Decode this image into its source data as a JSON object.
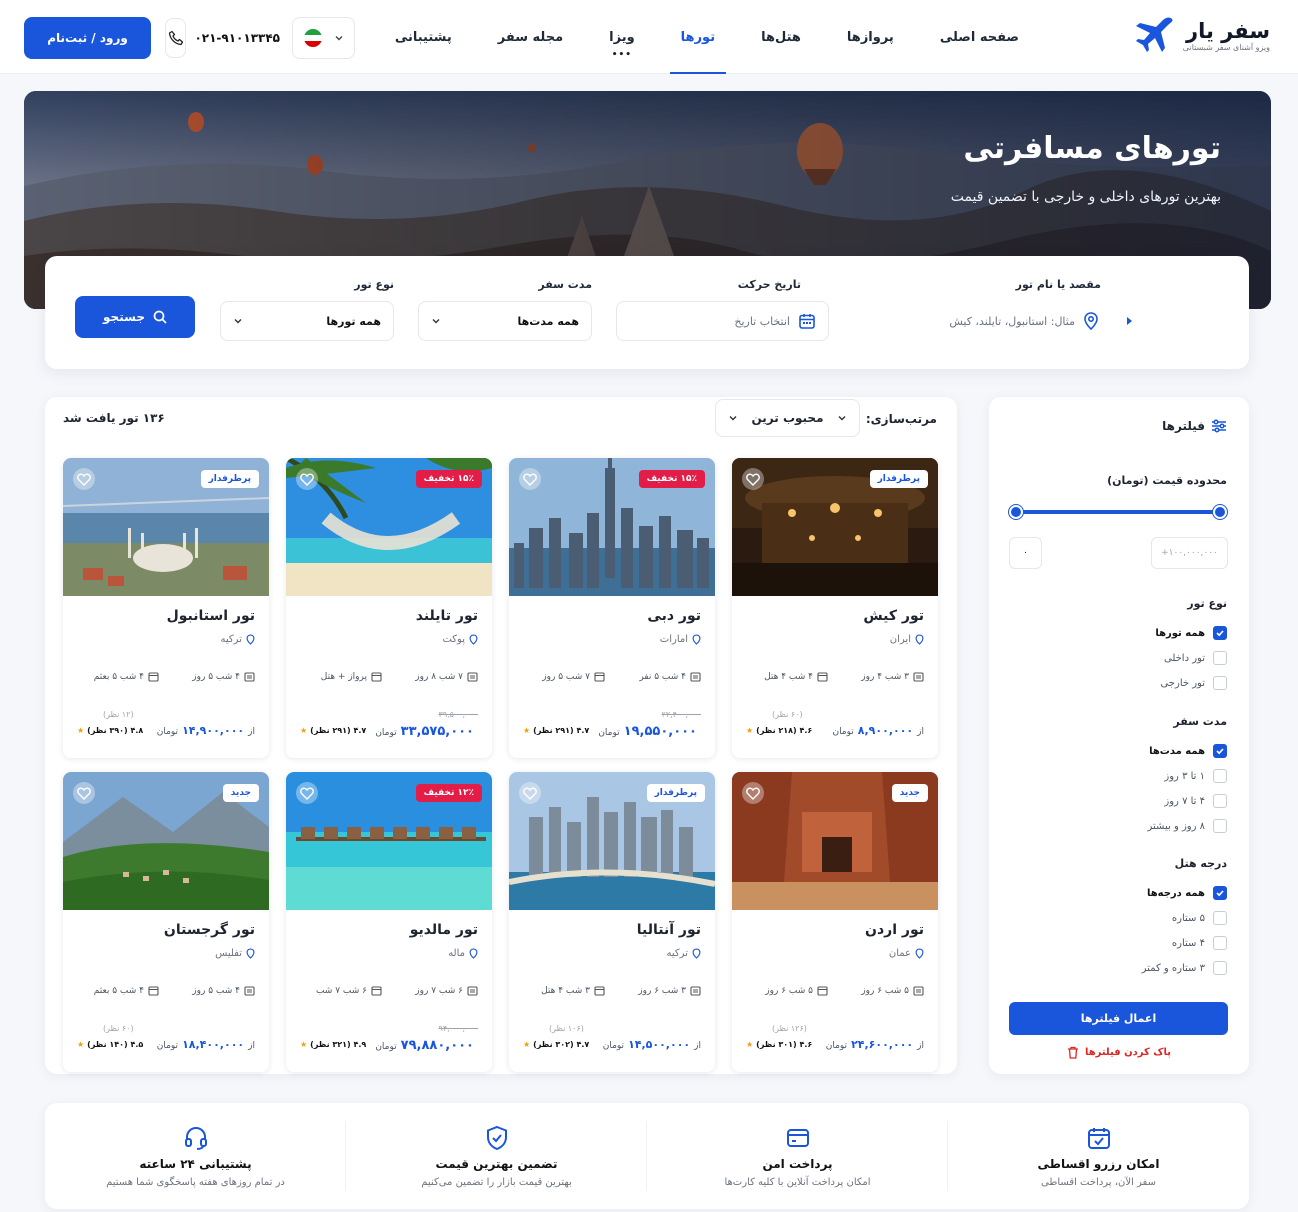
{
  "header": {
    "logo_title": "سفر یار",
    "logo_sub": "ویزو آشنای سفر شبستانی",
    "nav": [
      {
        "label": "صفحه اصلی",
        "active": false
      },
      {
        "label": "پروازها",
        "active": false
      },
      {
        "label": "هتل‌ها",
        "active": false
      },
      {
        "label": "تورها",
        "active": true
      },
      {
        "label": "ویزا",
        "active": false,
        "sub": "•••"
      },
      {
        "label": "مجله سفر",
        "active": false
      },
      {
        "label": "پشتیبانی",
        "active": false
      }
    ],
    "phone": "۰۲۱-۹۱۰۱۳۳۴۵",
    "login_label": "ورود / ثبت‌نام"
  },
  "hero": {
    "title": "تورهای مسافرتی",
    "subtitle": "بهترین تورهای داخلی و خارجی با تضمین قیمت"
  },
  "search": {
    "destination_label": "مقصد یا نام تور",
    "destination_placeholder": "مثال: استانبول، تایلند، کیش",
    "date_label": "تاریخ حرکت",
    "date_placeholder": "انتخاب تاریخ",
    "duration_label": "مدت سفر",
    "duration_value": "همه مدت‌ها",
    "type_label": "نوع تور",
    "type_value": "همه تورها",
    "search_label": "جستجو"
  },
  "results": {
    "sort_label": "مرتب‌سازی:",
    "sort_value": "محبوب ترین",
    "count_text": "۱۳۶ تور یافت شد"
  },
  "filters": {
    "title": "فیلترها",
    "price_title": "محدوده قیمت (تومان)",
    "price_min": "۰",
    "price_max": "۱۰۰,۰۰۰,۰۰۰+",
    "type_title": "نوع تور",
    "type_options": [
      {
        "label": "همه تورها",
        "checked": true
      },
      {
        "label": "تور داخلی",
        "checked": false
      },
      {
        "label": "تور خارجی",
        "checked": false
      }
    ],
    "duration_title": "مدت سفر",
    "duration_options": [
      {
        "label": "همه مدت‌ها",
        "checked": true
      },
      {
        "label": "۱ تا ۳ روز",
        "checked": false
      },
      {
        "label": "۴ تا ۷ روز",
        "checked": false
      },
      {
        "label": "۸ روز و بیشتر",
        "checked": false
      }
    ],
    "hotel_title": "درجه هتل",
    "hotel_options": [
      {
        "label": "همه درجه‌ها",
        "checked": true
      },
      {
        "label": "۵ ستاره",
        "checked": false
      },
      {
        "label": "۴ ستاره",
        "checked": false
      },
      {
        "label": "۳ ستاره و کمتر",
        "checked": false
      }
    ],
    "apply_label": "اعمال فیلترها",
    "clear_label": "پاک کردن فیلترها"
  },
  "tours": [
    {
      "title": "تور کیش",
      "location": "ایران",
      "badge": "پرطرفدار",
      "badge_style": "white",
      "feat1": "۳ شب ۴ روز",
      "feat2": "۴ شب ۴ هتل",
      "old_price": "",
      "reviews": "(۶۰ نظر)",
      "price_prefix": "از",
      "price": "۸,۹۰۰,۰۰۰",
      "currency": "تومان",
      "rating": "۴.۶ (۲۱۸ نظر)",
      "big": false,
      "img": "kish"
    },
    {
      "title": "تور دبی",
      "location": "امارات",
      "badge": "۱۵٪ تخفیف",
      "badge_style": "red",
      "feat1": "۴ شب ۵ نفر",
      "feat2": "۷ شب ۵ روز",
      "old_price": "۲۲,۴۰۰,۰۰۰",
      "reviews": "",
      "price_prefix": "",
      "price": "۱۹,۵۵۰,۰۰۰",
      "currency": "تومان",
      "rating": "۴.۷ (۲۹۱ نظر)",
      "big": true,
      "img": "dubai"
    },
    {
      "title": "تور تایلند",
      "location": "پوکت",
      "badge": "۱۵٪ تخفیف",
      "badge_style": "red",
      "feat1": "۷ شب ۸ روز",
      "feat2": "پرواز + هتل",
      "old_price": "۳۹,۵۰۰,۰۰۰",
      "reviews": "",
      "price_prefix": "",
      "price": "۳۳,۵۷۵,۰۰۰",
      "currency": "تومان",
      "rating": "۴.۷ (۲۹۱ نظر)",
      "big": true,
      "img": "thai"
    },
    {
      "title": "تور استانبول",
      "location": "ترکیه",
      "badge": "پرطرفدار",
      "badge_style": "white",
      "feat1": "۴ شب ۵ روز",
      "feat2": "۴ شب ۵ بعثم",
      "old_price": "",
      "reviews": "(۱۲ نظر)",
      "price_prefix": "از",
      "price": "۱۴,۹۰۰,۰۰۰",
      "currency": "تومان",
      "rating": "۴.۸ (۳۹۰ نظر)",
      "big": false,
      "img": "istanbul"
    },
    {
      "title": "تور اردن",
      "location": "عمان",
      "badge": "جدید",
      "badge_style": "white",
      "feat1": "۵ شب ۶ روز",
      "feat2": "۵ شب ۶ روز",
      "old_price": "",
      "reviews": "(۱۲۶ نظر)",
      "price_prefix": "از",
      "price": "۲۴,۶۰۰,۰۰۰",
      "currency": "تومان",
      "rating": "۴.۶ (۳۰۱ نظر)",
      "big": false,
      "img": "jordan"
    },
    {
      "title": "تور آنتالیا",
      "location": "ترکیه",
      "badge": "پرطرفدار",
      "badge_style": "white",
      "feat1": "۳ شب ۶ روز",
      "feat2": "۳ شب ۴ هتل",
      "old_price": "",
      "reviews": "(۱۰۶ نظر)",
      "price_prefix": "از",
      "price": "۱۴,۵۰۰,۰۰۰",
      "currency": "تومان",
      "rating": "۴.۷ (۳۰۲ نظر)",
      "big": false,
      "img": "antalya"
    },
    {
      "title": "تور مالدیو",
      "location": "ماله",
      "badge": "۱۲٪ تخفیف",
      "badge_style": "red",
      "feat1": "۶ شب ۷ روز",
      "feat2": "۶ شب ۷ شب",
      "old_price": "۹۴,۰۰۰,۰۰۰",
      "reviews": "",
      "price_prefix": "",
      "price": "۷۹,۸۸۰,۰۰۰",
      "currency": "تومان",
      "rating": "۴.۹ (۳۲۱ نظر)",
      "big": true,
      "img": "maldives"
    },
    {
      "title": "تور گرجستان",
      "location": "تفلیس",
      "badge": "جدید",
      "badge_style": "white",
      "feat1": "۴ شب ۵ روز",
      "feat2": "۴ شب ۵ بعثم",
      "old_price": "",
      "reviews": "(۶۰ نظر)",
      "price_prefix": "از",
      "price": "۱۸,۴۰۰,۰۰۰",
      "currency": "تومان",
      "rating": "۴.۵ (۱۴۰ نظر)",
      "big": false,
      "img": "georgia"
    }
  ],
  "features": [
    {
      "title": "امکان رزرو اقساطی",
      "desc": "سفر الآن، پرداخت اقساطی",
      "icon": "calendar-icon"
    },
    {
      "title": "پرداخت امن",
      "desc": "امکان پرداخت آنلاین با کلیه کارت‌ها",
      "icon": "card-icon"
    },
    {
      "title": "تضمین بهترین قیمت",
      "desc": "بهترین قیمت بازار را تضمین می‌کنیم",
      "icon": "shield-icon"
    },
    {
      "title": "پشتیبانی ۲۴ ساعته",
      "desc": "در تمام روزهای هفته پاسخگوی شما هستیم",
      "icon": "headset-icon"
    }
  ],
  "colors": {
    "primary": "#1a56db",
    "discount": "#e11d48",
    "star": "#f59e0b"
  }
}
